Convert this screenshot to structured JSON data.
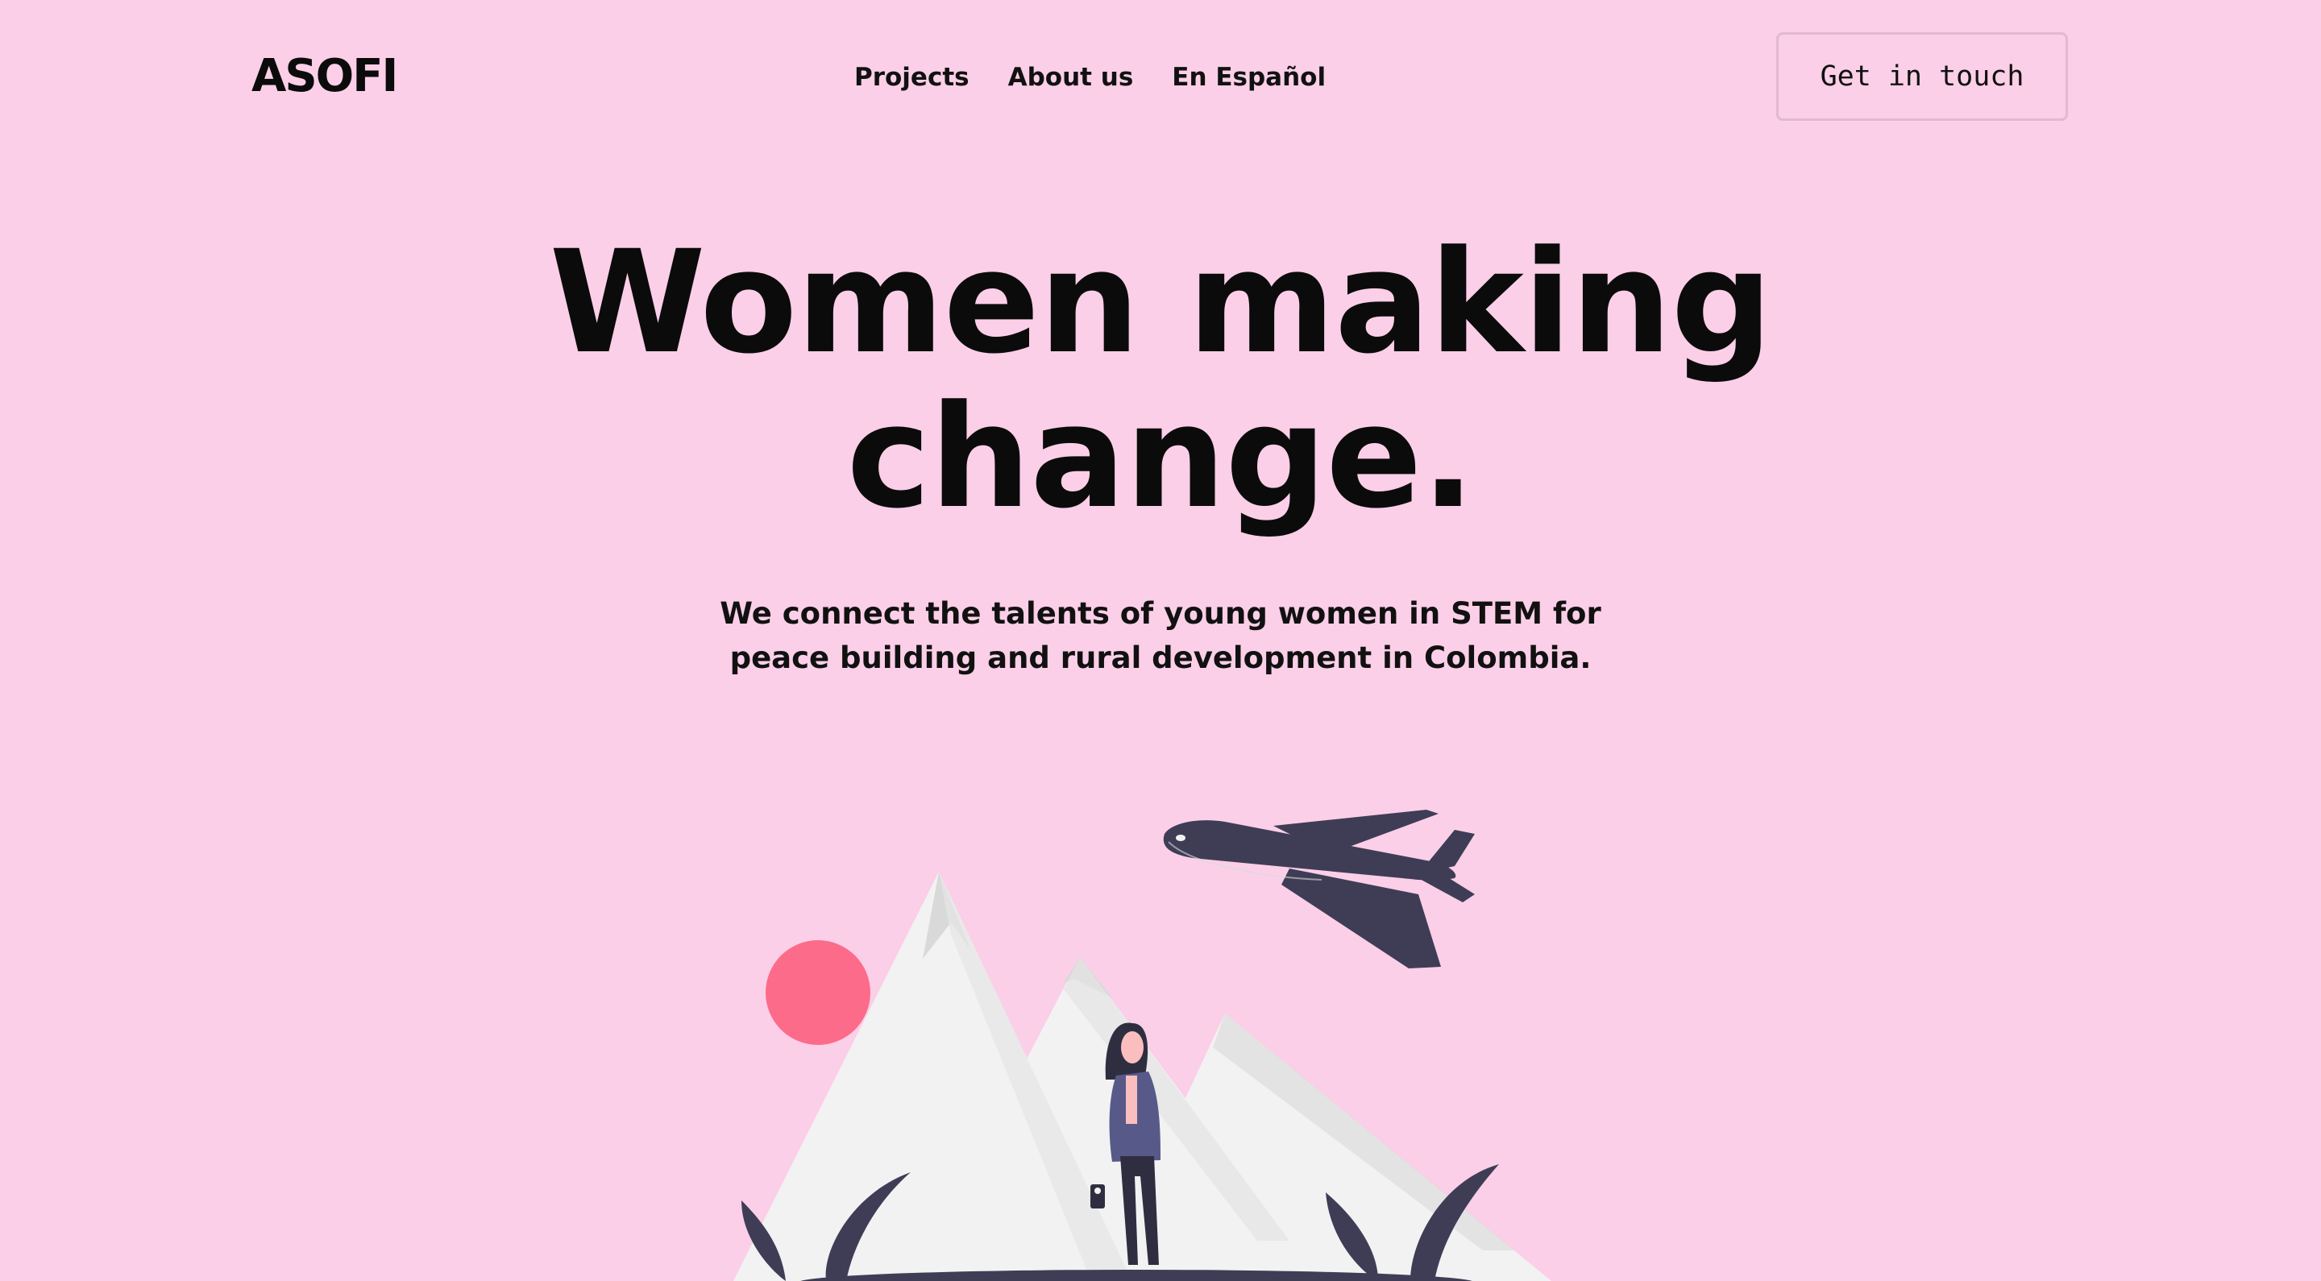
{
  "header": {
    "logo": "ASOFI",
    "nav": [
      {
        "label": "Projects"
      },
      {
        "label": "About us"
      },
      {
        "label": "En Español"
      }
    ],
    "cta_label": "Get in touch"
  },
  "hero": {
    "title_line1": "Women making",
    "title_line2": "change.",
    "subtitle": "We connect the talents of young women in STEM for peace building and rural development in Colombia."
  },
  "colors": {
    "background": "#fbcfe8",
    "text": "#0b0b0b",
    "sun": "#fc6b8a",
    "mountain": "#f2f2f2",
    "mountain_shadow": "#d9d9d9",
    "dark": "#3f3d56",
    "jacket": "#575a89"
  },
  "illustration": {
    "icon": "woman-mountains-airplane-illustration"
  }
}
